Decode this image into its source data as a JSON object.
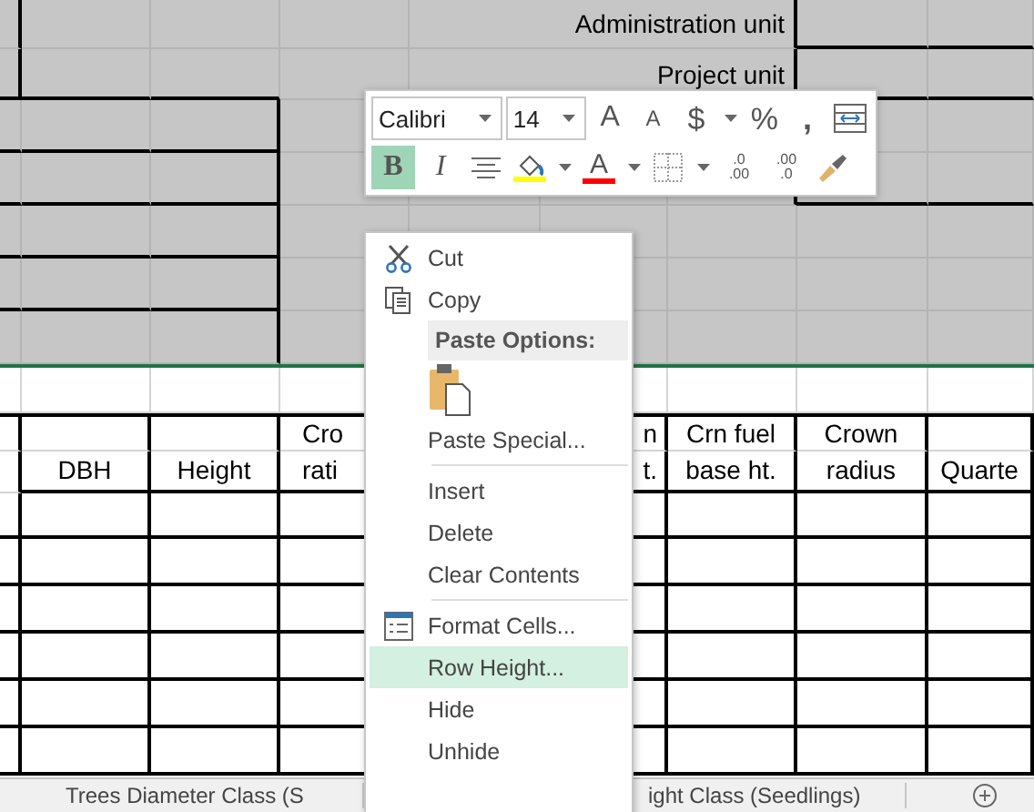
{
  "sheet": {
    "top_rows": [
      {
        "label": "Administration unit"
      },
      {
        "label": "Project unit"
      }
    ],
    "header_columns": [
      {
        "line_2": "DBH"
      },
      {
        "line_2": "Height"
      },
      {
        "line_1": "Cro",
        "line_2": "rati"
      },
      {},
      {
        "line_1": "n",
        "line_2": "t."
      },
      {
        "line_1": "Crn fuel",
        "line_2": "base ht."
      },
      {
        "line_1": "Crown",
        "line_2": "radius"
      },
      {
        "line_2": "Quarte"
      }
    ]
  },
  "mini_toolbar": {
    "font": "Calibri",
    "size": "14",
    "row_1": [
      {
        "kind": "grow-font",
        "label": "A"
      },
      {
        "kind": "shrink-font",
        "label": "A"
      },
      {
        "kind": "currency",
        "label": "$"
      },
      {
        "kind": "caret"
      },
      {
        "kind": "percent",
        "label": "%"
      },
      {
        "kind": "comma",
        "label": ","
      },
      {
        "kind": "wrap"
      }
    ],
    "row_2": [
      {
        "kind": "bold",
        "label": "B",
        "selected": true
      },
      {
        "kind": "italic",
        "label": "I",
        "selected": false
      },
      {
        "kind": "align"
      },
      {
        "kind": "fill",
        "color": "#ffff00"
      },
      {
        "kind": "caret"
      },
      {
        "kind": "font-color",
        "label": "A",
        "color": "#ff0000"
      },
      {
        "kind": "caret"
      },
      {
        "kind": "borders"
      },
      {
        "kind": "caret"
      },
      {
        "kind": "inc-decimal",
        "top": ".0",
        "bottom": ".00"
      },
      {
        "kind": "dec-decimal",
        "top": ".00",
        "bottom": ".0"
      },
      {
        "kind": "painter"
      }
    ]
  },
  "context_menu": [
    {
      "kind": "cut",
      "label": "Cut",
      "selected": false
    },
    {
      "kind": "copy",
      "label": "Copy",
      "selected": false
    },
    {
      "kind": "header",
      "label": "Paste Options:"
    },
    {
      "kind": "paste"
    },
    {
      "kind": "item",
      "label": "Paste Special...",
      "selected": false
    },
    {
      "kind": "separator"
    },
    {
      "kind": "item",
      "label": "Insert",
      "selected": false
    },
    {
      "kind": "item",
      "label": "Delete",
      "selected": false
    },
    {
      "kind": "item",
      "label": "Clear Contents",
      "selected": false
    },
    {
      "kind": "separator"
    },
    {
      "kind": "format",
      "label": "Format Cells...",
      "selected": false
    },
    {
      "kind": "item",
      "label": "Row Height...",
      "selected": true
    },
    {
      "kind": "item",
      "label": "Hide",
      "selected": false
    },
    {
      "kind": "item",
      "label": "Unhide",
      "selected": false
    }
  ],
  "sheet_tabs": [
    {
      "label": "Trees Diameter Class (S"
    },
    {
      "label": "ight Class (Seedlings)"
    }
  ]
}
